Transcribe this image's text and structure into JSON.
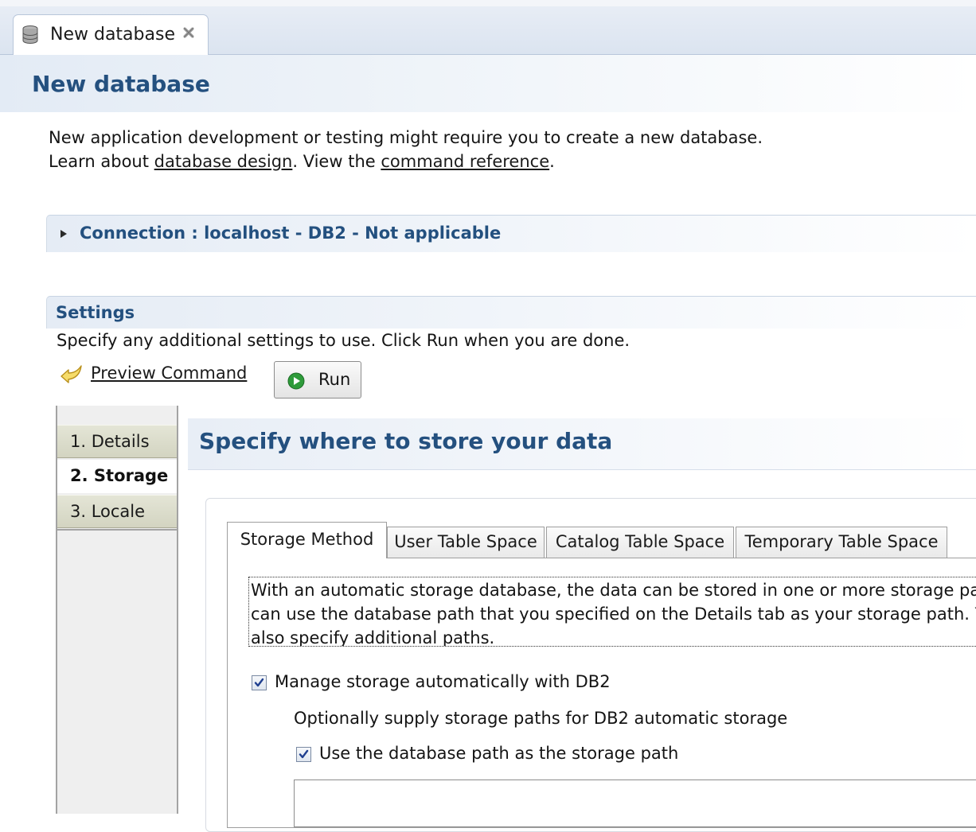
{
  "editor_tab": {
    "label": "New database",
    "icon": "database-icon",
    "close_icon": "close-icon"
  },
  "page": {
    "title": "New database"
  },
  "intro": {
    "line1": "New application development or testing might require you to create a new database.",
    "line2_prefix": "Learn about ",
    "link1": "database design",
    "line2_middle": ". View the ",
    "link2": "command reference",
    "line2_suffix": "."
  },
  "connection": {
    "label": "Connection : localhost - DB2 - Not applicable",
    "expand_icon": "triangle-right-icon"
  },
  "settings": {
    "title": "Settings",
    "description": "Specify any additional settings to use. Click Run when you are done.",
    "preview_label": "Preview Command",
    "preview_icon": "preview-arrow-icon",
    "run_label": "Run",
    "run_icon": "run-icon"
  },
  "nav": {
    "items": [
      {
        "label": "1. Details",
        "active": false
      },
      {
        "label": "2. Storage",
        "active": true
      },
      {
        "label": "3. Locale",
        "active": false
      }
    ]
  },
  "content": {
    "title": "Specify where to store your data",
    "tabs": [
      {
        "label": "Storage Method",
        "active": true
      },
      {
        "label": "User Table Space",
        "active": false
      },
      {
        "label": "Catalog Table Space",
        "active": false
      },
      {
        "label": "Temporary Table Space",
        "active": false
      }
    ],
    "description_lines": [
      "With an automatic storage database, the data can be stored in one or more storage pat",
      "can use the database path that you specified on the Details tab as your storage path. Yo",
      "also specify additional paths."
    ],
    "manage_auto_label": "Manage storage automatically with DB2",
    "manage_auto_checked": true,
    "optional_label": "Optionally supply storage paths for DB2 automatic storage",
    "use_db_path_label": "Use the database path as the storage path",
    "use_db_path_checked": true
  },
  "colors": {
    "title_blue": "#24507f",
    "nav_tab": "#d8d9c6",
    "run_green": "#2e9b3a"
  }
}
